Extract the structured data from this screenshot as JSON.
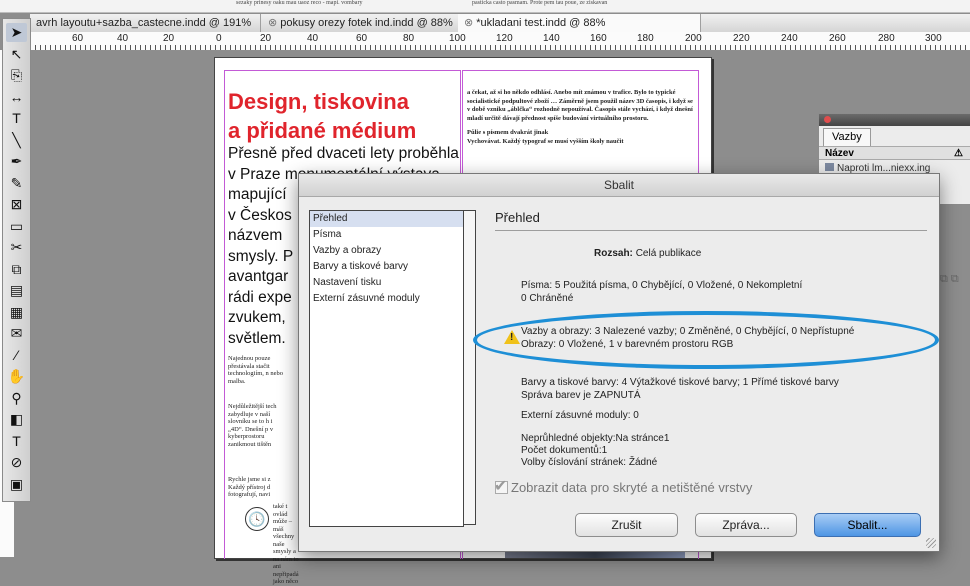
{
  "top_strip": {
    "left_text": "sezaky prinesy oaku mau uaoz reco - mapi. vombary",
    "right_text": "pasticka casto pasmam. Prote pem tau poue, ze ziskavan"
  },
  "tabs": [
    {
      "label": "avrh layoutu+sazba_castecne.indd @ 191%"
    },
    {
      "label": "pokusy orezy fotek ind.indd @ 88%"
    },
    {
      "label": "*ukladani test.indd @ 88%"
    }
  ],
  "ruler": {
    "labels": [
      "60",
      "40",
      "20",
      "0",
      "20",
      "40",
      "60",
      "80",
      "100",
      "120",
      "140",
      "160",
      "180",
      "200",
      "220",
      "240",
      "260",
      "280",
      "300"
    ]
  },
  "tools": [
    {
      "icon": "selection-arrow-icon",
      "glyph": "➤"
    },
    {
      "icon": "direct-selection-icon",
      "glyph": "↖"
    },
    {
      "icon": "page-tool-icon",
      "glyph": "⎘"
    },
    {
      "icon": "gap-tool-icon",
      "glyph": "↔"
    },
    {
      "icon": "type-tool-icon",
      "glyph": "T"
    },
    {
      "icon": "line-tool-icon",
      "glyph": "╲"
    },
    {
      "icon": "pen-tool-icon",
      "glyph": "✒"
    },
    {
      "icon": "pencil-tool-icon",
      "glyph": "✎"
    },
    {
      "icon": "rectangle-frame-icon",
      "glyph": "⊠"
    },
    {
      "icon": "rectangle-tool-icon",
      "glyph": "▭"
    },
    {
      "icon": "scissors-icon",
      "glyph": "✂"
    },
    {
      "icon": "free-transform-icon",
      "glyph": "⧉"
    },
    {
      "icon": "gradient-swatch-icon",
      "glyph": "▤"
    },
    {
      "icon": "gradient-feather-icon",
      "glyph": "▦"
    },
    {
      "icon": "note-tool-icon",
      "glyph": "✉"
    },
    {
      "icon": "eyedropper-icon",
      "glyph": "⁄"
    },
    {
      "icon": "hand-tool-icon",
      "glyph": "✋"
    },
    {
      "icon": "zoom-tool-icon",
      "glyph": "⚲"
    },
    {
      "icon": "fill-stroke-icon",
      "glyph": "◧"
    },
    {
      "icon": "formatting-affects-icon",
      "glyph": "T"
    },
    {
      "icon": "apply-none-icon",
      "glyph": "⊘"
    },
    {
      "icon": "screen-mode-icon",
      "glyph": "▣"
    }
  ],
  "document": {
    "headline_1": "Design, tiskovina",
    "headline_2": "a přidané médium",
    "body_lines": [
      "Přesně před dvaceti lety proběhla",
      "v Praze monumentální výstava",
      "mapující",
      "v Českos",
      "názvem",
      "smysly. P",
      "avantgar",
      "rádi expe",
      "zvukem,",
      "světlem."
    ],
    "small_para_1": "Najednou pouze přestávala stačit technologiím, n nebo malba.",
    "small_para_2": "Nejdůležitější tech zabydluje v naší slovníku se to h i „4D“. Dnešní p v kyberprostoru zanikmout tištěn",
    "small_para_3": "Rychle jsme si z Každý přístroj d fotografují, navi",
    "small_para_4": "také t ovlád může – máš všechny naše smysly a na nám to ani nepřipadá jako něco",
    "col2_para_1": "a čekat, až si ho někdo odhlásí. Anebo mít známou v trafice. Bylo to typické socialistické podpultové zboží … Záměrně jsem použil název 3D časopis, i když se v době vzniku „áblčka“ rozhodně nepoužíval. Časopis stále vychází, i když dnešní mladí určitě dávají přednost spíše budování virtuálního prostoru.",
    "col2_para_2": "Půlie s písmem dvakrát jinak",
    "col2_para_3": "Vychovávat. Každý typograf se musí vyšším školy naučit"
  },
  "links_panel": {
    "tab": "Vazby",
    "column_name": "Název",
    "row": "Naproti lm...niexx.ing"
  },
  "dialog": {
    "title": "Sbalit",
    "nav_items": [
      "Přehled",
      "Písma",
      "Vazby a obrazy",
      "Barvy a tiskové barvy",
      "Nastavení tisku",
      "Externí zásuvné moduly"
    ],
    "section_title": "Přehled",
    "scope_label": "Rozsah:",
    "scope_value": "Celá publikace",
    "fonts_line1": "Písma: 5 Použitá písma, 0 Chybějící, 0 Vložené, 0 Nekompletní",
    "fonts_line2": "0 Chráněné",
    "links_line1": "Vazby a obrazy: 3 Nalezené vazby; 0 Změněné, 0 Chybějící, 0 Nepřístupné",
    "links_line2": "Obrazy: 0 Vložené, 1 v barevném prostoru RGB",
    "colors_line1": "Barvy a tiskové barvy: 4 Výtažkové tiskové barvy; 1 Přímé tiskové barvy",
    "colors_line2": "Správa barev je ZAPNUTÁ",
    "plugins_line": "Externí zásuvné moduly: 0",
    "opaque_line1": "Neprůhledné objekty:Na stránce1",
    "opaque_line2": "Počet dokumentů:1",
    "opaque_line3": "Volby číslování stránek: Žádné",
    "checkbox_label": "Zobrazit data pro skryté a netištěné vrstvy",
    "btn_cancel": "Zrušit",
    "btn_report": "Zpráva...",
    "btn_package": "Sbalit..."
  },
  "colors": {
    "headline_red": "#e0242c",
    "highlight_blue": "#1e8fd6",
    "warning_yellow": "#f0c21a",
    "default_button_blue": "#4e95e4"
  }
}
